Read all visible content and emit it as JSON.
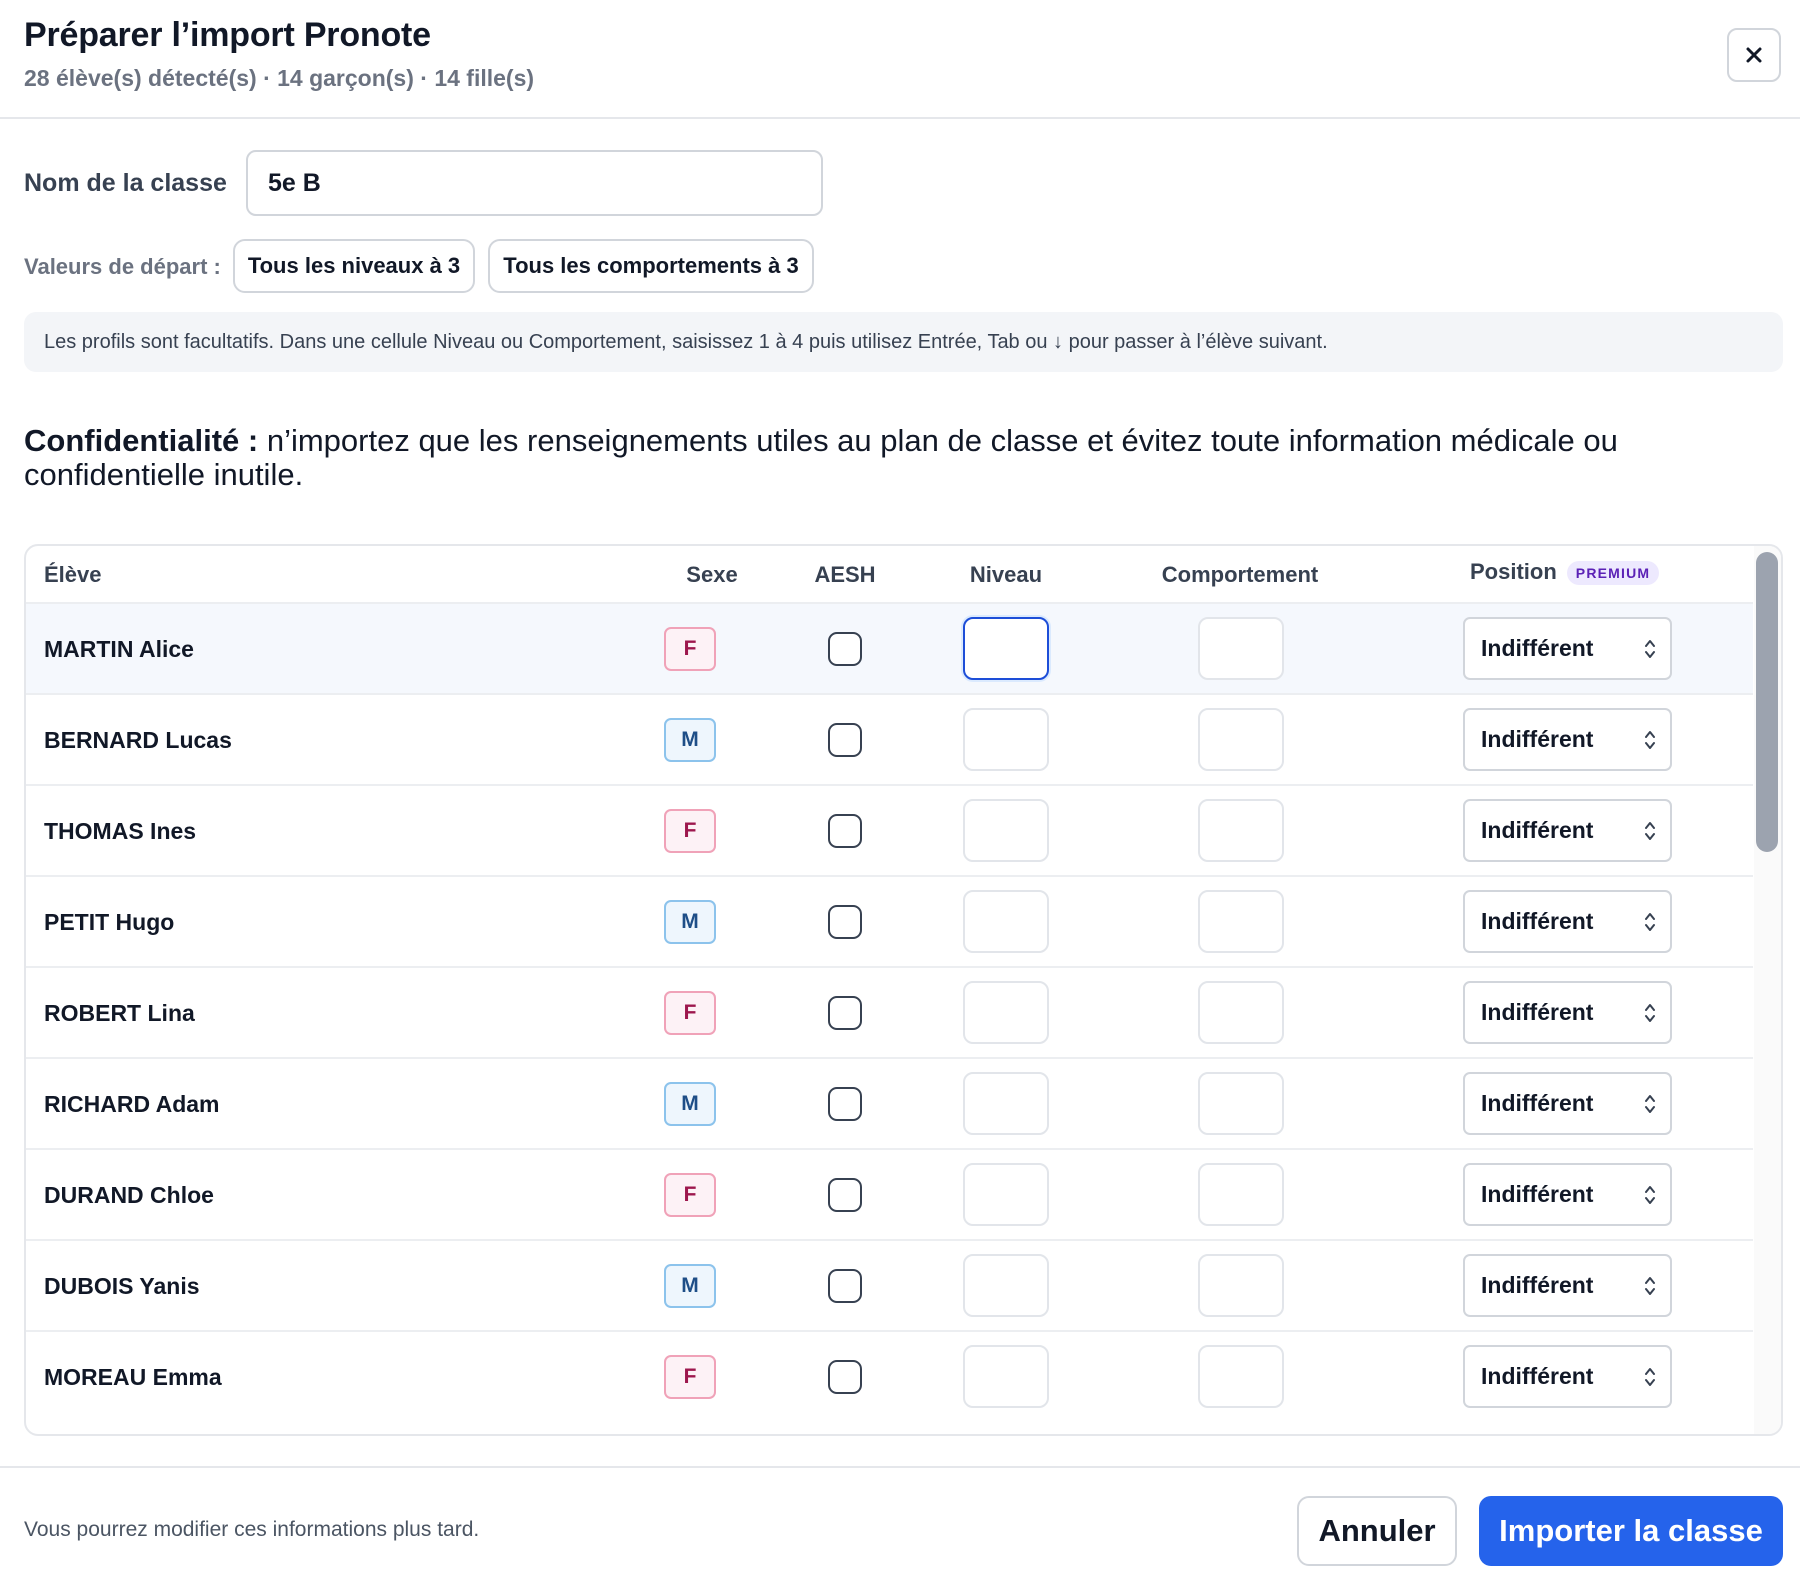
{
  "header": {
    "title": "Préparer l’import Pronote",
    "subtitle": "28 élève(s) détecté(s) · 14 garçon(s) · 14 fille(s)",
    "close_icon": "close-icon"
  },
  "form": {
    "class_name_label": "Nom de la classe",
    "class_name_value": "5e B",
    "start_values_label": "Valeurs de départ :",
    "preset_levels": "Tous les niveaux à 3",
    "preset_behaviors": "Tous les comportements à 3"
  },
  "info": "Les profils sont facultatifs. Dans une cellule Niveau ou Comportement, saisissez 1 à 4 puis utilisez Entrée, Tab ou ↓ pour passer à l’élève suivant.",
  "privacy": {
    "bold": "Confidentialité :",
    "text": " n’importez que les renseignements utiles au plan de classe et évitez toute information médicale ou confidentielle inutile."
  },
  "table": {
    "headers": {
      "student": "Élève",
      "sex": "Sexe",
      "aesh": "AESH",
      "level": "Niveau",
      "behavior": "Comportement",
      "position": "Position",
      "premium": "PREMIUM"
    },
    "rows": [
      {
        "name": "MARTIN Alice",
        "sex": "F",
        "aesh": false,
        "level": "",
        "behavior": "",
        "position": "Indifférent"
      },
      {
        "name": "BERNARD Lucas",
        "sex": "M",
        "aesh": false,
        "level": "",
        "behavior": "",
        "position": "Indifférent"
      },
      {
        "name": "THOMAS Ines",
        "sex": "F",
        "aesh": false,
        "level": "",
        "behavior": "",
        "position": "Indifférent"
      },
      {
        "name": "PETIT Hugo",
        "sex": "M",
        "aesh": false,
        "level": "",
        "behavior": "",
        "position": "Indifférent"
      },
      {
        "name": "ROBERT Lina",
        "sex": "F",
        "aesh": false,
        "level": "",
        "behavior": "",
        "position": "Indifférent"
      },
      {
        "name": "RICHARD Adam",
        "sex": "M",
        "aesh": false,
        "level": "",
        "behavior": "",
        "position": "Indifférent"
      },
      {
        "name": "DURAND Chloe",
        "sex": "F",
        "aesh": false,
        "level": "",
        "behavior": "",
        "position": "Indifférent"
      },
      {
        "name": "DUBOIS Yanis",
        "sex": "M",
        "aesh": false,
        "level": "",
        "behavior": "",
        "position": "Indifférent"
      },
      {
        "name": "MOREAU Emma",
        "sex": "F",
        "aesh": false,
        "level": "",
        "behavior": "",
        "position": "Indifférent"
      }
    ]
  },
  "footer": {
    "note": "Vous pourrez modifier ces informations plus tard.",
    "cancel": "Annuler",
    "import": "Importer la classe"
  },
  "colors": {
    "primary": "#2563eb",
    "female_badge_border": "#f0a2b8",
    "male_badge_border": "#8cc3ec",
    "premium_badge_text": "#5b21b6"
  }
}
